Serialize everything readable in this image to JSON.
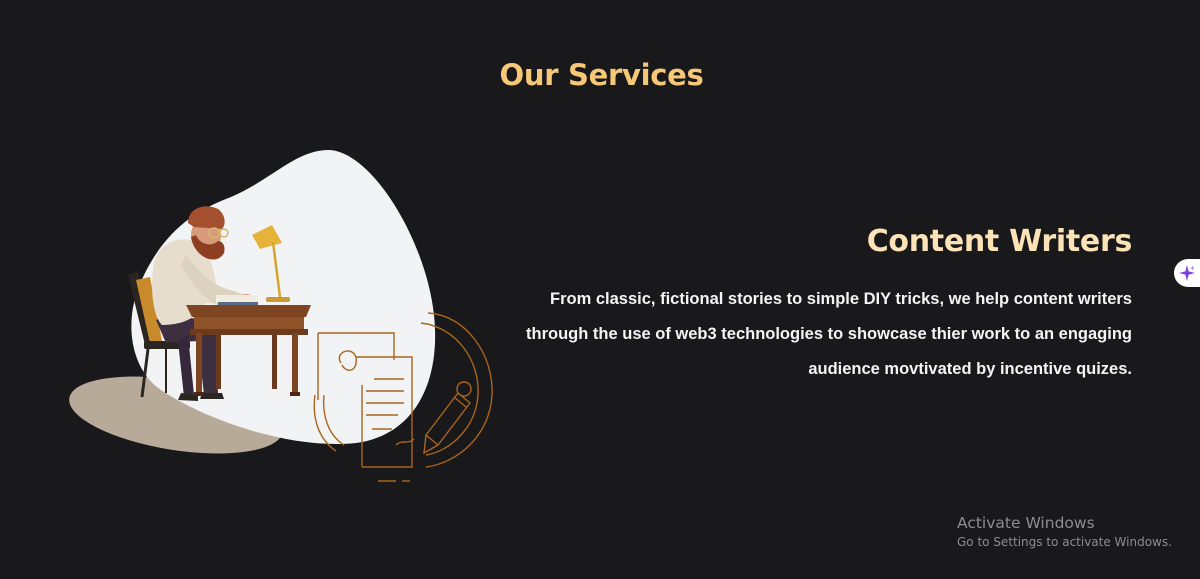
{
  "section": {
    "title": "Our Services"
  },
  "service": {
    "heading": "Content Writers",
    "description": "From classic, fictional stories to simple DIY tricks, we help content writers through the use of web3 technologies to showcase thier work to an engaging audience movtivated by incentive quizes."
  },
  "illustration": {
    "subject": "writer-at-desk",
    "icons": [
      "writer-figure",
      "desk-lamp-icon",
      "document-pen-icon"
    ]
  },
  "floating_button": {
    "icon": "sparkle-icon",
    "color": "#7b3fe4"
  },
  "windows_watermark": {
    "title": "Activate Windows",
    "subtitle": "Go to Settings to activate Windows."
  },
  "colors": {
    "background": "#19191b",
    "title": "#f6c878",
    "heading": "#fbe3b7",
    "body_text": "#f4f4f4",
    "accent_brown": "#a9651c"
  }
}
